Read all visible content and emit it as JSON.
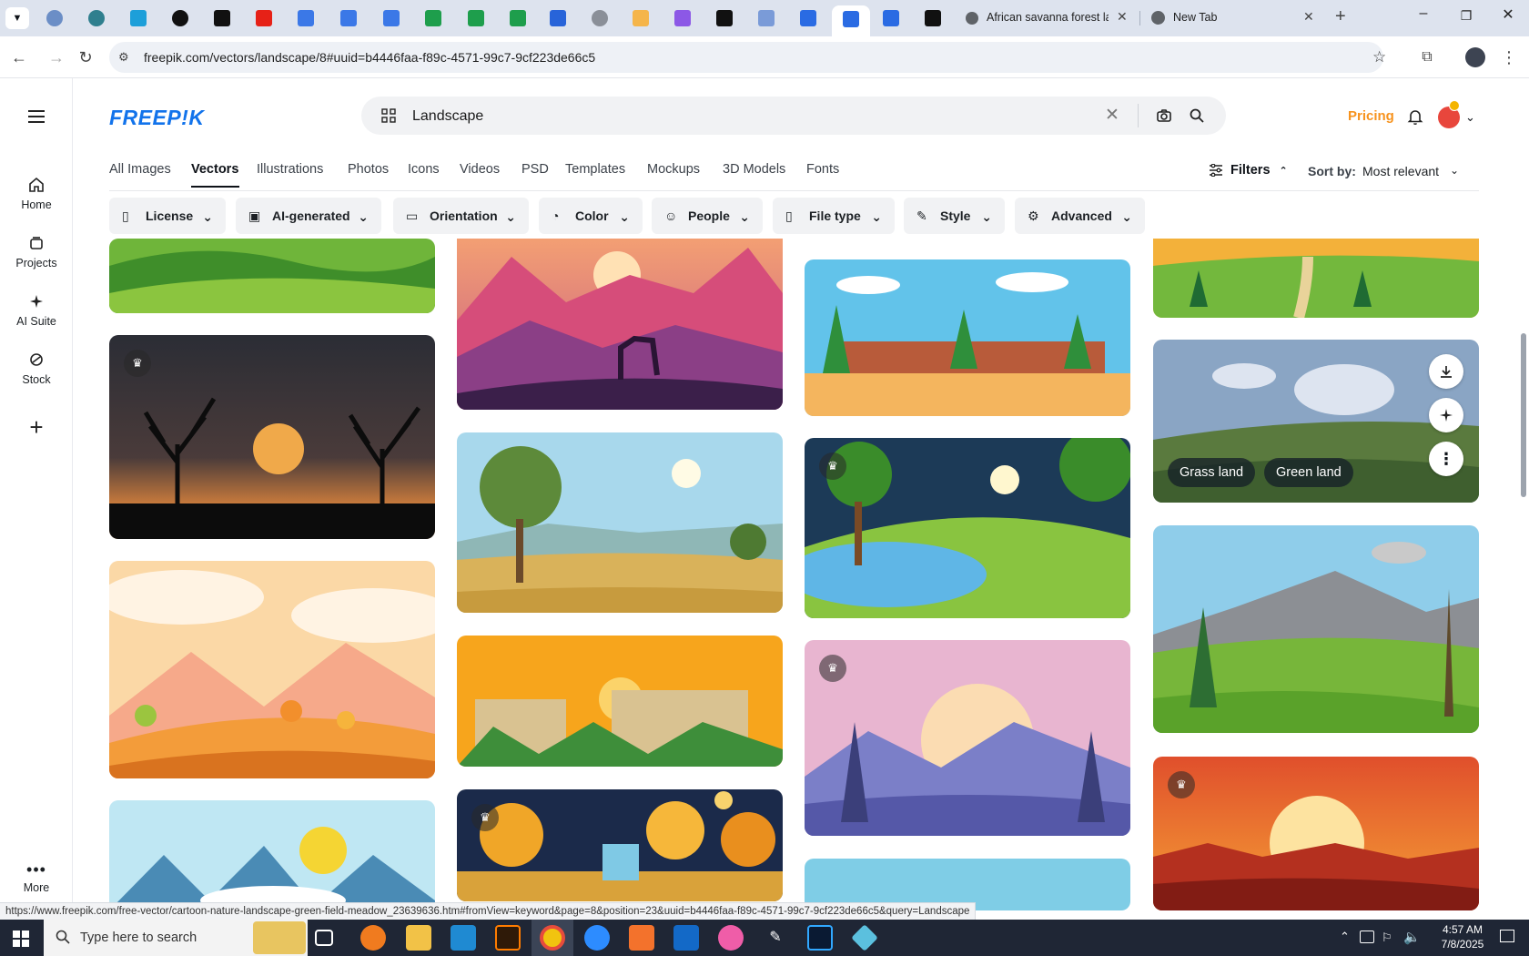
{
  "browser": {
    "tabs": [
      {
        "title": "African savanna forest la"
      },
      {
        "title": "New Tab"
      }
    ],
    "url": "freepik.com/vectors/landscape/8#uuid=b4446faa-f89c-4571-99c7-9cf223de66c5",
    "status_url": "https://www.freepik.com/free-vector/cartoon-nature-landscape-green-field-meadow_23639636.htm#fromView=keyword&page=8&position=23&uuid=b4446faa-f89c-4571-99c7-9cf223de66c5&query=Landscape"
  },
  "sidebar": {
    "items": [
      {
        "label": "Home"
      },
      {
        "label": "Projects"
      },
      {
        "label": "AI Suite"
      },
      {
        "label": "Stock"
      }
    ],
    "more_label": "More"
  },
  "header": {
    "logo": "FREEP!K",
    "search_value": "Landscape",
    "pricing": "Pricing"
  },
  "categories": [
    "All Images",
    "Vectors",
    "Illustrations",
    "Photos",
    "Icons",
    "Videos",
    "PSD",
    "Templates",
    "Mockups",
    "3D Models",
    "Fonts"
  ],
  "sort": {
    "filters_label": "Filters",
    "sort_label": "Sort by:",
    "sort_value": "Most relevant"
  },
  "filters": [
    "License",
    "AI-generated",
    "Orientation",
    "Color",
    "People",
    "File type",
    "Style",
    "Advanced"
  ],
  "hover_tags": [
    "Grass land",
    "Green land"
  ],
  "taskbar": {
    "search_placeholder": "Type here to search",
    "time": "4:57 AM",
    "date": "7/8/2025"
  },
  "colors": {
    "brand": "#1273eb",
    "pricing": "#f7931e"
  }
}
